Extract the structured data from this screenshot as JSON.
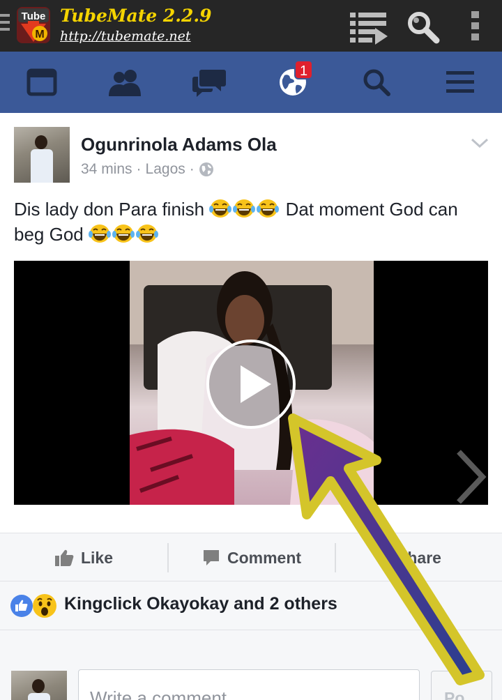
{
  "tubemate": {
    "logo_text_top": "Tube",
    "logo_text_bottom": "M",
    "title": "TubeMate 2.2.9",
    "url": "http://tubemate.net",
    "icons": [
      "menu-icon",
      "download-list-icon",
      "search-icon",
      "overflow-menu-icon"
    ]
  },
  "fb_nav": {
    "items": [
      {
        "name": "news-feed-icon"
      },
      {
        "name": "friend-requests-icon"
      },
      {
        "name": "messages-icon"
      },
      {
        "name": "notifications-icon",
        "badge": "1"
      },
      {
        "name": "search-icon"
      },
      {
        "name": "more-menu-icon"
      }
    ],
    "colors": {
      "bar": "#3b5998",
      "badge": "#e0202d"
    }
  },
  "post": {
    "author": "Ogunrinola Adams Ola",
    "time": "34 mins",
    "location": "Lagos",
    "separator": "·",
    "privacy_icon": "globe-icon",
    "text_line1": "Dis lady don Para finish",
    "text_line1_after": "Dat moment God can",
    "text_line2": "beg God",
    "emoji": "face-with-tears-of-joy",
    "video": {
      "play_icon": "play-icon",
      "next_icon": "chevron-right-icon"
    }
  },
  "actions": {
    "like": "Like",
    "comment": "Comment",
    "share": "Share"
  },
  "reactions": {
    "icons": [
      "like-reaction-icon",
      "wow-reaction-icon"
    ],
    "text": "Kingclick Okayokay and 2 others"
  },
  "composer": {
    "placeholder": "Write a comment...",
    "post_label": "Po"
  },
  "annotation": {
    "arrow_color": "#d4c52a"
  }
}
